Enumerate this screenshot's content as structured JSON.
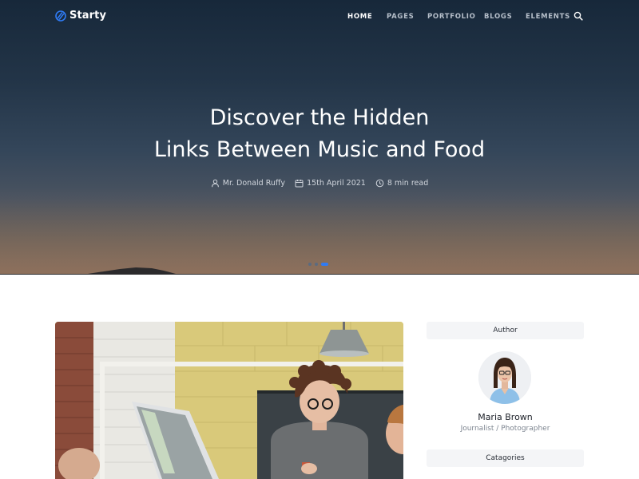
{
  "brand": {
    "name": "Starty",
    "accent": "#2f7bf5"
  },
  "nav": {
    "items": [
      {
        "label": "HOME",
        "active": true
      },
      {
        "label": "PAGES",
        "active": false
      },
      {
        "label": "PORTFOLIO",
        "active": false
      },
      {
        "label": "BLOGS",
        "active": false
      },
      {
        "label": "ELEMENTS",
        "active": false
      }
    ],
    "search_icon": "search-icon"
  },
  "hero": {
    "title_line1": "Discover the Hidden",
    "title_line2": "Links Between Music and Food",
    "meta": {
      "author": "Mr. Donald Ruffy",
      "date": "15th April 2021",
      "read_time": "8 min read"
    },
    "slides": {
      "count": 3,
      "active": 3
    }
  },
  "sidebar": {
    "author_heading": "Author",
    "author_name": "Maria Brown",
    "author_role": "Journalist / Photographer",
    "categories_heading": "Catagories"
  }
}
